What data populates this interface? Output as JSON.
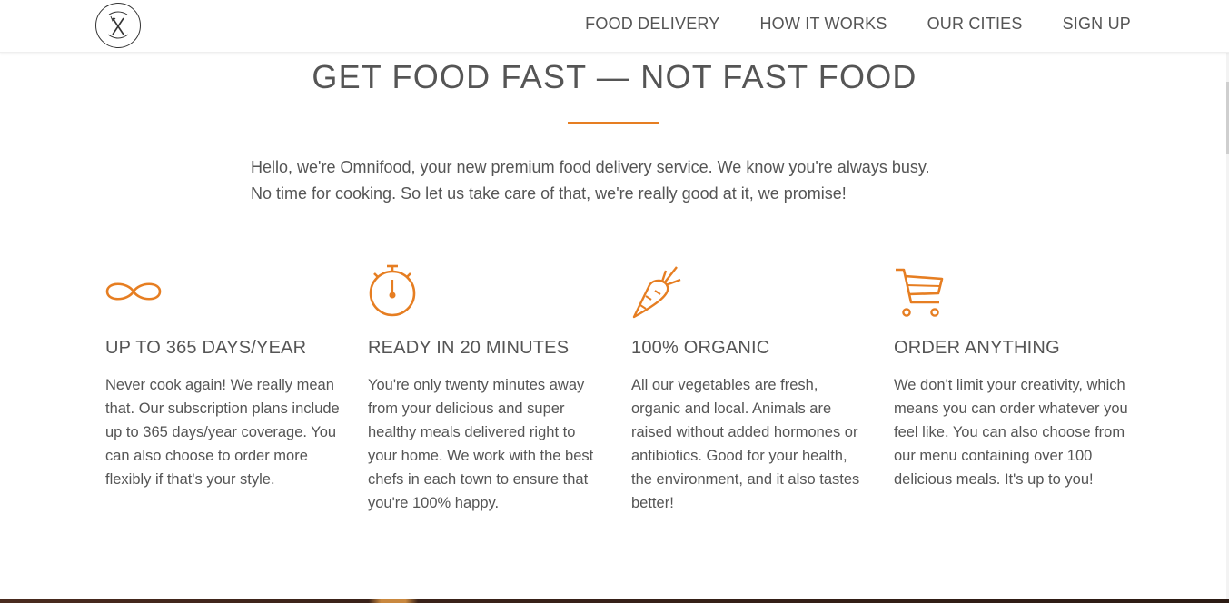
{
  "header": {
    "logo_icon": "omnifood-fork-knife-logo",
    "nav": [
      {
        "label": "FOOD DELIVERY"
      },
      {
        "label": "HOW IT WORKS"
      },
      {
        "label": "OUR CITIES"
      },
      {
        "label": "SIGN UP"
      }
    ]
  },
  "section": {
    "title": "GET FOOD FAST — NOT FAST FOOD",
    "intro_line1": "Hello, we're Omnifood, your new premium food delivery service. We know you're always busy.",
    "intro_line2": "No time for cooking. So let us take care of that, we're really good at it, we promise!",
    "accent_color": "#e67e22",
    "features": [
      {
        "icon": "infinity-icon",
        "title": "UP TO 365 DAYS/YEAR",
        "text": "Never cook again! We really mean that. Our subscription plans include up to 365 days/year coverage. You can also choose to order more flexibly if that's your style."
      },
      {
        "icon": "stopwatch-icon",
        "title": "READY IN 20 MINUTES",
        "text": "You're only twenty minutes away from your delicious and super healthy meals delivered right to your home. We work with the best chefs in each town to ensure that you're 100% happy."
      },
      {
        "icon": "carrot-icon",
        "title": "100% ORGANIC",
        "text": "All our vegetables are fresh, organic and local. Animals are raised without added hormones or antibiotics. Good for your health, the environment, and it also tastes better!"
      },
      {
        "icon": "cart-icon",
        "title": "ORDER ANYTHING",
        "text": "We don't limit your creativity, which means you can order whatever you feel like. You can also choose from our menu containing over 100 delicious meals. It's up to you!"
      }
    ]
  }
}
